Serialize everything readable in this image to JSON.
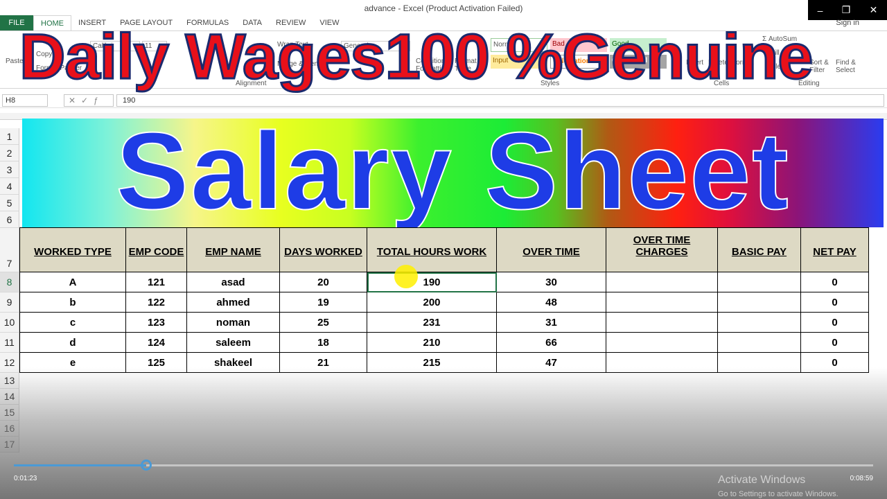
{
  "window": {
    "title": "advance - Excel (Product Activation Failed)",
    "sign_in": "Sign in",
    "controls": [
      "–",
      "❐",
      "✕"
    ]
  },
  "tabs": [
    "FILE",
    "HOME",
    "INSERT",
    "PAGE LAYOUT",
    "FORMULAS",
    "DATA",
    "REVIEW",
    "VIEW"
  ],
  "ribbon": {
    "paste": "Paste",
    "copy": "Copy",
    "format_painter": "Format Painter",
    "font": "Calibri",
    "font_size": "11",
    "wrap_text": "Wrap Text",
    "merge": "Merge & Center",
    "number_format": "General",
    "conditional": "Conditional Formatting",
    "format_table": "Format as Table",
    "styles": {
      "normal": "Normal",
      "bad": "Bad",
      "good": "Good",
      "input": "Input",
      "calculation": "Calculation",
      "check": "Check Cell"
    },
    "styles_label": "Styles",
    "insert": "Insert",
    "delete": "Delete",
    "format": "Format",
    "cells_label": "Cells",
    "autosum": "AutoSum",
    "fill": "Fill",
    "clear": "Clear",
    "sort": "Sort & Filter",
    "find": "Find & Select",
    "editing_label": "Editing",
    "alignment_label": "Alignment"
  },
  "formula_bar": {
    "name_box": "H8",
    "value": "190"
  },
  "overlay_text": "Daily Wages100 %Genuine",
  "banner_text": "Salary Sheet",
  "row_numbers": [
    "1",
    "2",
    "3",
    "4",
    "5",
    "6",
    "7",
    "8",
    "9",
    "10",
    "11",
    "12",
    "13",
    "14",
    "15",
    "16",
    "17"
  ],
  "table": {
    "headers": [
      "WORKED TYPE",
      "EMP CODE",
      "EMP NAME",
      "DAYS WORKED",
      "TOTAL HOURS WORK",
      "OVER TIME",
      "OVER TIME CHARGES",
      "BASIC PAY",
      "NET PAY"
    ],
    "rows": [
      [
        "A",
        "121",
        "asad",
        "20",
        "190",
        "30",
        "",
        "",
        "0"
      ],
      [
        "b",
        "122",
        "ahmed",
        "19",
        "200",
        "48",
        "",
        "",
        "0"
      ],
      [
        "c",
        "123",
        "noman",
        "25",
        "231",
        "31",
        "",
        "",
        "0"
      ],
      [
        "d",
        "124",
        "saleem",
        "18",
        "210",
        "66",
        "",
        "",
        "0"
      ],
      [
        "e",
        "125",
        "shakeel",
        "21",
        "215",
        "47",
        "",
        "",
        "0"
      ]
    ]
  },
  "player": {
    "current_time": "0:01:23",
    "duration": "0:08:59",
    "progress_percent": 15.4
  },
  "watermark": {
    "line1": "Activate Windows",
    "line2": "Go to Settings to activate Windows."
  }
}
